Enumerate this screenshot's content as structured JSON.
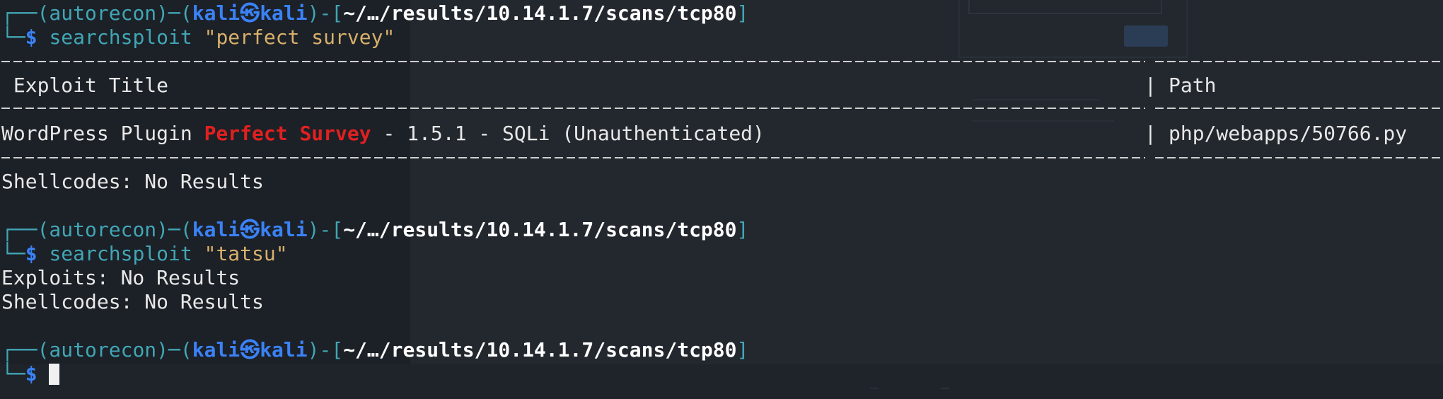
{
  "prompt": {
    "env": "(autorecon)",
    "user": "kali",
    "host": "kali",
    "path": "~/…/results/10.14.1.7/scans/tcp80",
    "symbol": "$"
  },
  "blocks": [
    {
      "command": "searchsploit",
      "argument": "\"perfect survey\""
    },
    {
      "command": "searchsploit",
      "argument": "\"tatsu\""
    }
  ],
  "results_table": {
    "headers": {
      "title": "Exploit Title",
      "separator": "|",
      "path": "Path"
    },
    "rows": [
      {
        "title_prefix": "WordPress Plugin ",
        "title_highlight": "Perfect Survey",
        "title_suffix": " - 1.5.1 - SQLi (Unauthenticated)",
        "separator": "|",
        "path": "php/webapps/50766.py"
      }
    ]
  },
  "messages": {
    "shellcodes_1": "Shellcodes: No Results",
    "exploits_2": "Exploits: No Results",
    "shellcodes_2": "Shellcodes: No Results"
  },
  "colors": {
    "background": "#1c2027",
    "frame": "#41a6b5",
    "user": "#3a82f6",
    "string": "#d7b06b",
    "highlight": "#e02020"
  }
}
